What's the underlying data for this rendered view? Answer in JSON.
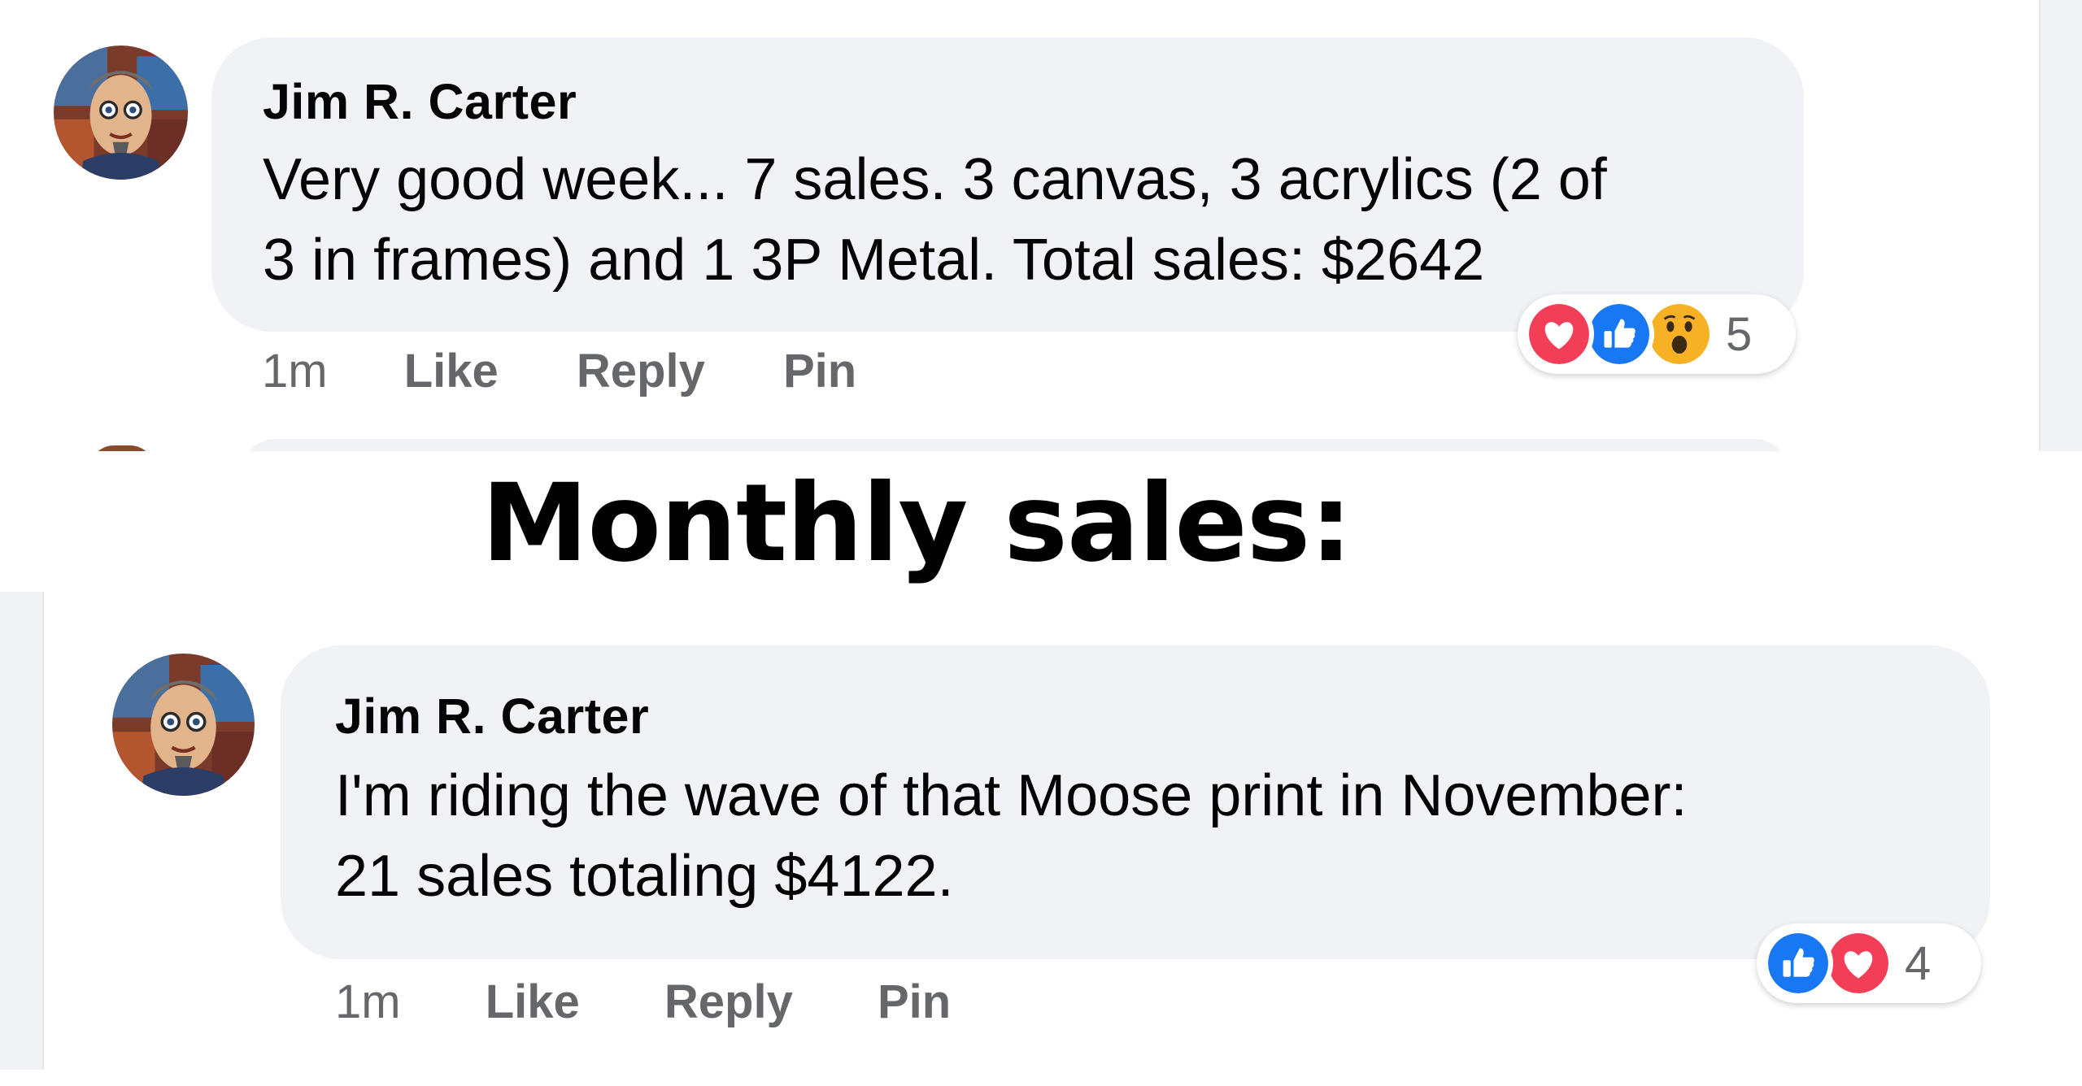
{
  "heading": "Monthly sales:",
  "comments": [
    {
      "author": "Jim R. Carter",
      "text": "Very good week... 7 sales. 3 canvas, 3 acrylics (2 of\n3 in frames) and 1 3P Metal. Total sales: $2642",
      "time": "1m",
      "actions": [
        "Like",
        "Reply",
        "Pin"
      ],
      "reactions": [
        "love",
        "like",
        "wow"
      ],
      "reaction_count": "5"
    },
    {
      "author": "Jim R. Carter",
      "text": "I'm riding the wave of that Moose print in November:\n21 sales totaling $4122.",
      "time": "1m",
      "actions": [
        "Like",
        "Reply",
        "Pin"
      ],
      "reactions": [
        "like",
        "love"
      ],
      "reaction_count": "4"
    }
  ],
  "colors": {
    "bubble": "#f0f2f5",
    "meta_text": "#65676b",
    "like_blue": "#1877f2",
    "love_red": "#f33e58",
    "wow_yellow": "#f7b125"
  },
  "icons": [
    "avatar-portrait",
    "love-reaction-icon",
    "like-reaction-icon",
    "wow-reaction-icon"
  ]
}
